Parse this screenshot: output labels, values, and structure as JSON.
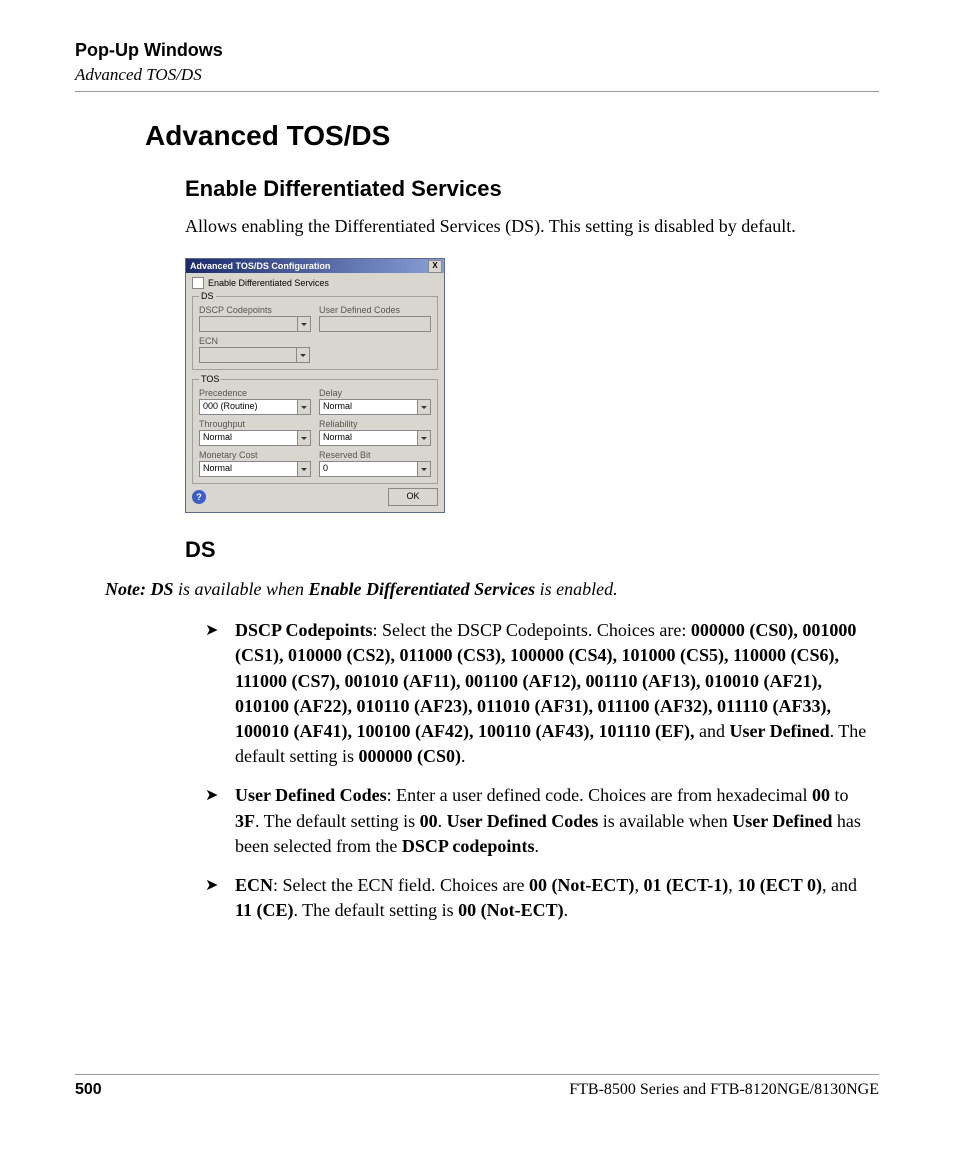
{
  "header": {
    "section": "Pop-Up Windows",
    "breadcrumb": "Advanced TOS/DS"
  },
  "h1": "Advanced TOS/DS",
  "h2": "Enable Differentiated Services",
  "intro": "Allows enabling the Differentiated Services (DS). This setting is disabled by default.",
  "dialog": {
    "title": "Advanced TOS/DS Configuration",
    "close": "X",
    "enable_label": "Enable Differentiated Services",
    "ds_legend": "DS",
    "tos_legend": "TOS",
    "labels": {
      "dscp": "DSCP Codepoints",
      "udc": "User Defined Codes",
      "ecn": "ECN",
      "precedence": "Precedence",
      "delay": "Delay",
      "throughput": "Throughput",
      "reliability": "Reliability",
      "monetary": "Monetary Cost",
      "reserved": "Reserved Bit"
    },
    "values": {
      "dscp": "",
      "udc": "",
      "ecn": "",
      "precedence": "000 (Routine)",
      "delay": "Normal",
      "throughput": "Normal",
      "reliability": "Normal",
      "monetary": "Normal",
      "reserved": "0"
    },
    "help": "?",
    "ok": "OK"
  },
  "h3": "DS",
  "note": {
    "label": "Note:",
    "prefix": "DS",
    "mid1": " is available when ",
    "bold": "Enable Differentiated Services",
    "suffix": " is enabled."
  },
  "bullets": {
    "b1": {
      "lead": "DSCP Codepoints",
      "t1": ": Select the DSCP Codepoints. Choices are: ",
      "codes": "000000 (CS0), 001000 (CS1), 010000 (CS2), 011000 (CS3), 100000 (CS4), 101000 (CS5), 110000 (CS6), 111000 (CS7), 001010 (AF11), 001100 (AF12), 001110 (AF13), 010010 (AF21), 010100 (AF22), 010110 (AF23), 011010 (AF31), 011100 (AF32), 011110 (AF33), 100010 (AF41), 100100 (AF42), 100110 (AF43), 101110 (EF),",
      "t2": " and ",
      "ud": "User Defined",
      "t3": ". The default setting is ",
      "def": "000000 (CS0)",
      "t4": "."
    },
    "b2": {
      "lead": "User Defined Codes",
      "t1": ": Enter a user defined code. Choices are from hexadecimal ",
      "v1": "00",
      "t2": " to ",
      "v2": "3F",
      "t3": ". The default setting is ",
      "v3": "00",
      "t4": ". ",
      "v4": "User Defined Codes",
      "t5": " is available when ",
      "v5": "User Defined",
      "t6": " has been selected from the ",
      "v6": "DSCP codepoints",
      "t7": "."
    },
    "b3": {
      "lead": "ECN",
      "t1": ": Select the ECN field. Choices are ",
      "v1": "00 (Not-ECT)",
      "t2": ", ",
      "v2": "01 (ECT-1)",
      "t3": ", ",
      "v3": "10 (ECT 0)",
      "t4": ", and ",
      "v4": "11 (CE)",
      "t5": ". The default setting is ",
      "v5": "00 (Not-ECT)",
      "t6": "."
    }
  },
  "footer": {
    "page": "500",
    "product": "FTB-8500 Series and FTB-8120NGE/8130NGE"
  }
}
